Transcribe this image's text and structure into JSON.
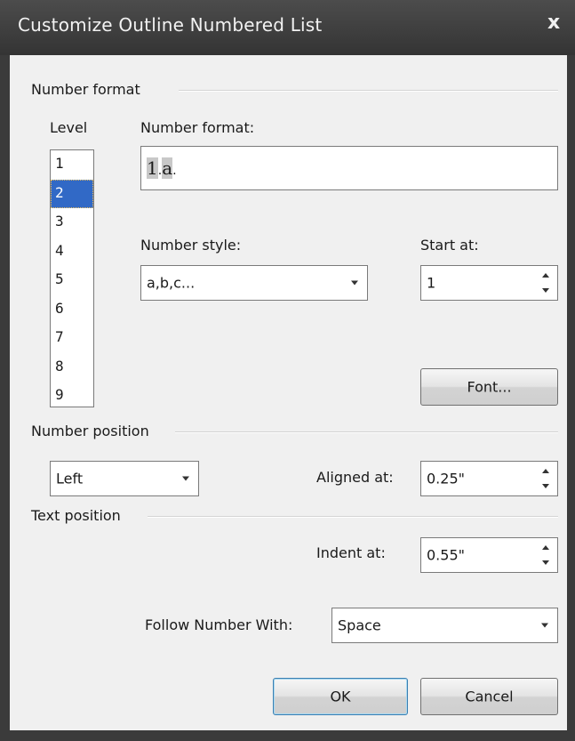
{
  "window": {
    "title": "Customize Outline Numbered List",
    "close_glyph": "x"
  },
  "number_format_group": {
    "heading": "Number format",
    "level_label": "Level",
    "levels": [
      "1",
      "2",
      "3",
      "4",
      "5",
      "6",
      "7",
      "8",
      "9"
    ],
    "selected_level": "2",
    "number_format_label": "Number format:",
    "number_format_value": {
      "part1": "1",
      "sep1": ".",
      "part2": "a",
      "sep2": "."
    },
    "number_style_label": "Number style:",
    "number_style_value": "a,b,c...",
    "start_at_label": "Start at:",
    "start_at_value": "1",
    "font_button": "Font..."
  },
  "number_position_group": {
    "heading": "Number position",
    "alignment_value": "Left",
    "aligned_at_label": "Aligned at:",
    "aligned_at_value": "0.25\""
  },
  "text_position_group": {
    "heading": "Text position",
    "indent_at_label": "Indent at:",
    "indent_at_value": "0.55\""
  },
  "follow_number_with_label": "Follow Number With:",
  "follow_number_with_value": "Space",
  "buttons": {
    "ok": "OK",
    "cancel": "Cancel"
  }
}
